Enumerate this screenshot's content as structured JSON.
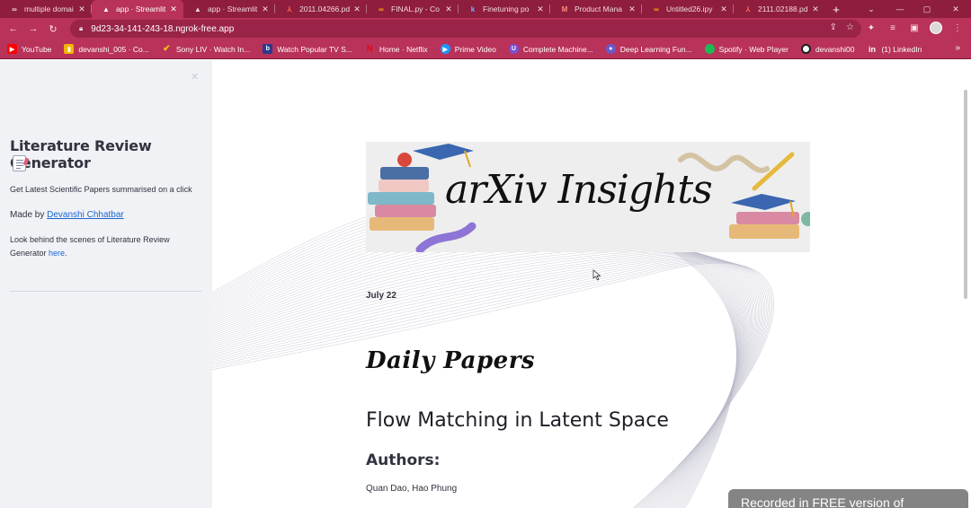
{
  "tabs": [
    {
      "title": "multiple domai",
      "icon": "colab-icon",
      "icon_glyph": "∞",
      "active": false
    },
    {
      "title": "app · Streamlit",
      "icon": "streamlit-icon",
      "icon_glyph": "▲",
      "active": true
    },
    {
      "title": "app · Streamlit",
      "icon": "streamlit-icon",
      "icon_glyph": "▲",
      "active": false
    },
    {
      "title": "2011.04266.pd",
      "icon": "pdf-icon",
      "icon_glyph": "⅄",
      "active": false
    },
    {
      "title": "FINAL.py - Co",
      "icon": "colab-icon",
      "icon_glyph": "∞",
      "active": false
    },
    {
      "title": "Finetuning po",
      "icon": "k-icon",
      "icon_glyph": "k",
      "active": false
    },
    {
      "title": "Product Mana",
      "icon": "gmail-icon",
      "icon_glyph": "M",
      "active": false
    },
    {
      "title": "Untitled26.ipy",
      "icon": "colab-icon",
      "icon_glyph": "∞",
      "active": false
    },
    {
      "title": "2111.02188.pd",
      "icon": "pdf-icon",
      "icon_glyph": "⅄",
      "active": false
    }
  ],
  "address_bar": {
    "url": "9d23-34-141-243-18.ngrok-free.app"
  },
  "bookmarks": [
    {
      "label": "YouTube",
      "icon": "youtube-icon",
      "color": "#ff0000",
      "glyph": "▶"
    },
    {
      "label": "devanshi_005 · Co...",
      "icon": "chart-icon",
      "color": "#f4b400",
      "glyph": "▮"
    },
    {
      "label": "Sony LIV · Watch In...",
      "icon": "sonyliv-icon",
      "color": "#e6b800",
      "glyph": "✔"
    },
    {
      "label": "Watch Popular TV S...",
      "icon": "tv-icon",
      "color": "#2b3a8f",
      "glyph": "b"
    },
    {
      "label": "Home · Netflix",
      "icon": "netflix-icon",
      "color": "#e50914",
      "glyph": "N"
    },
    {
      "label": "Prime Video",
      "icon": "primevideo-icon",
      "color": "#1a98ff",
      "glyph": "▶"
    },
    {
      "label": "Complete Machine...",
      "icon": "udemy-icon",
      "color": "#7a4fd1",
      "glyph": "U"
    },
    {
      "label": "Deep Learning Fun...",
      "icon": "coursera-icon",
      "color": "#6a5acd",
      "glyph": "●"
    },
    {
      "label": "Spotify · Web Player",
      "icon": "spotify-icon",
      "color": "#1db954",
      "glyph": "●"
    },
    {
      "label": "devanshi00",
      "icon": "github-icon",
      "color": "#1f1f1f",
      "glyph": "●"
    },
    {
      "label": "(1) LinkedIn",
      "icon": "linkedin-icon",
      "color": "#0a66c2",
      "glyph": "in"
    }
  ],
  "sidebar": {
    "title": "Literature Review Generator",
    "tagline": "Get Latest Scientific Papers summarised on a click",
    "made_by_prefix": "Made by ",
    "made_by_name": "Devanshi Chhatbar",
    "behind_text": "Look behind the scenes of Literature Review Generator ",
    "behind_link": "here",
    "behind_suffix": "."
  },
  "main": {
    "banner_text": "arXiv Insights",
    "date": "July 22",
    "section_title": "Daily Papers",
    "paper_title": "Flow Matching in Latent Space",
    "authors_heading": "Authors:",
    "authors": "Quan Dao, Hao Phung"
  },
  "watermark": "Recorded in FREE version of",
  "colors": {
    "tab_strip": "#8e1d3e",
    "toolbar": "#b8325a",
    "sidebar_bg": "#f0f2f6",
    "link": "#1a66d1"
  }
}
